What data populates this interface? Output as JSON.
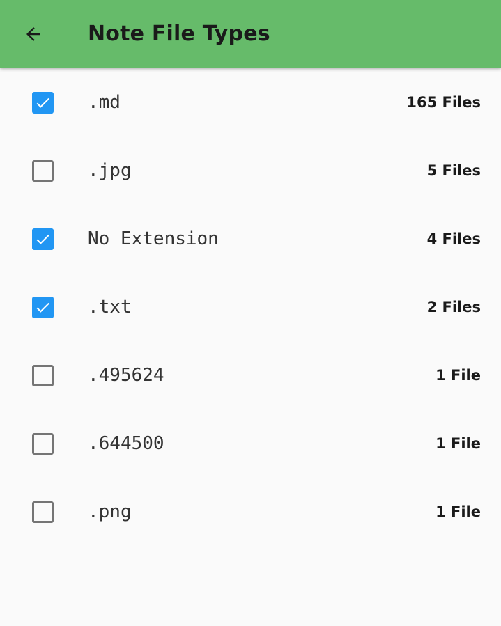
{
  "app_bar": {
    "title": "Note File Types",
    "back_icon": "arrow-left-icon",
    "color": "#66bb6a"
  },
  "checkbox_colors": {
    "checked": "#2196f3",
    "unchecked": "#757575"
  },
  "file_types": [
    {
      "extension": ".md",
      "count": "165 Files",
      "checked": true
    },
    {
      "extension": ".jpg",
      "count": "5 Files",
      "checked": false
    },
    {
      "extension": "No Extension",
      "count": "4 Files",
      "checked": true
    },
    {
      "extension": ".txt",
      "count": "2 Files",
      "checked": true
    },
    {
      "extension": ".495624",
      "count": "1 File",
      "checked": false
    },
    {
      "extension": ".644500",
      "count": "1 File",
      "checked": false
    },
    {
      "extension": ".png",
      "count": "1 File",
      "checked": false
    }
  ]
}
